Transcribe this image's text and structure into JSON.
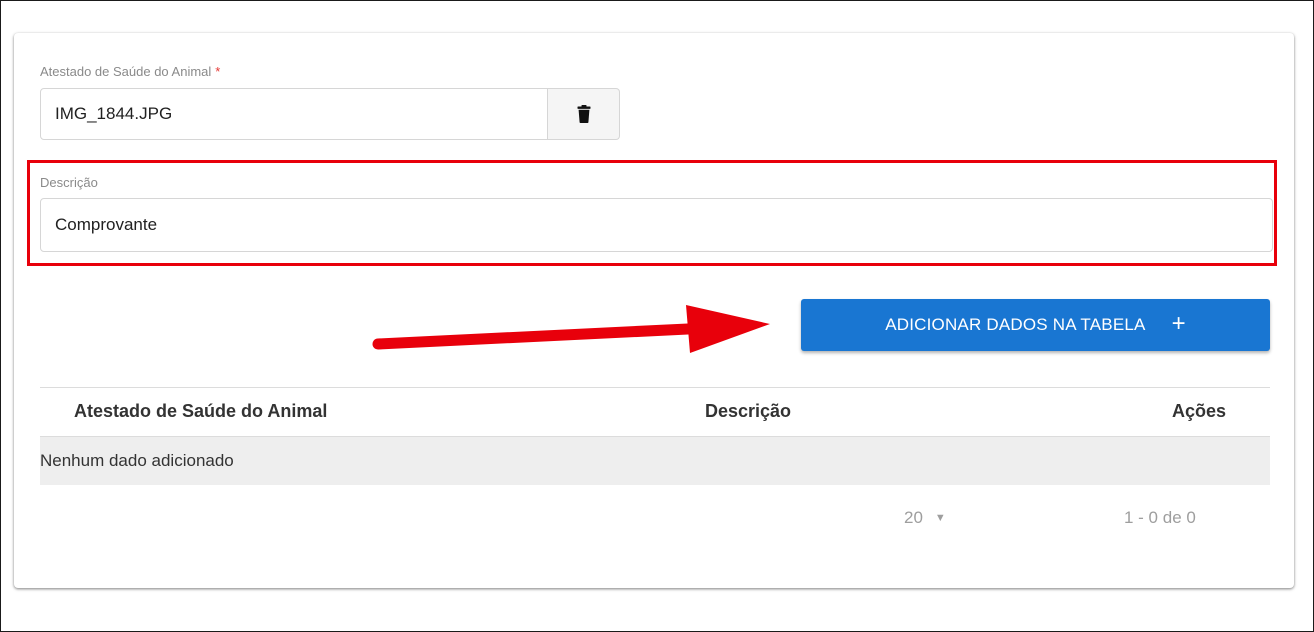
{
  "form": {
    "attachment_label": "Atestado de Saúde do Animal",
    "required_mark": "*",
    "attachment_value": "IMG_1844.JPG",
    "description_label": "Descrição",
    "description_value": "Comprovante",
    "add_button_label": "ADICIONAR DADOS NA TABELA",
    "add_button_icon": "plus-icon",
    "delete_button_icon": "trash-icon"
  },
  "annotations": {
    "highlight_color": "#e8000b",
    "arrow_color": "#e8000b"
  },
  "table": {
    "columns": [
      "Atestado de Saúde do Animal",
      "Descrição",
      "Ações"
    ],
    "rows": [],
    "empty_message": "Nenhum dado adicionado"
  },
  "pagination": {
    "page_size": "20",
    "range_text": "1 - 0 de 0"
  },
  "colors": {
    "primary": "#1976d2",
    "required": "#e53935"
  }
}
